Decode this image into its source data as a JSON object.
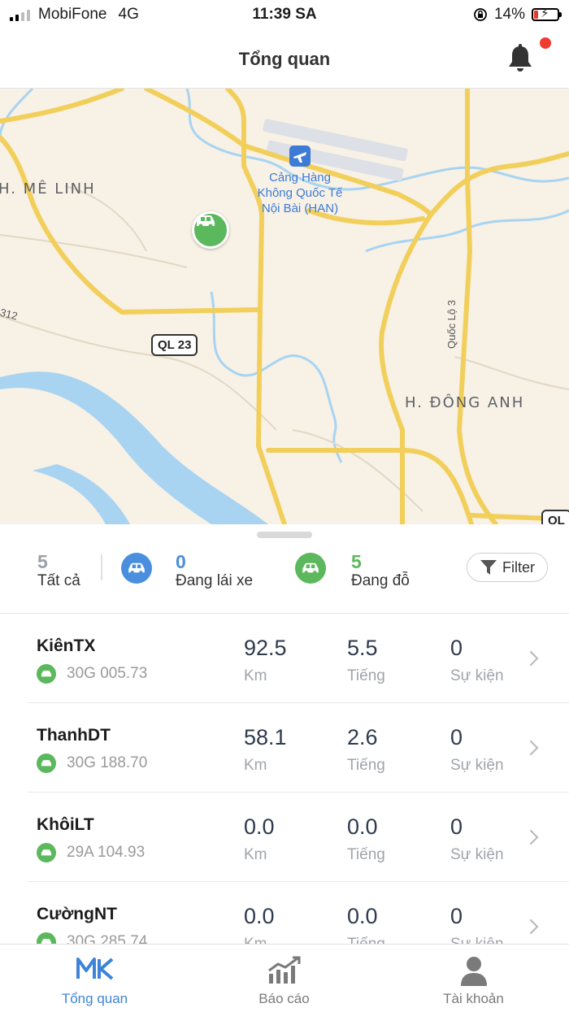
{
  "status_bar": {
    "carrier": "MobiFone",
    "network": "4G",
    "time": "11:39 SA",
    "battery": "14%"
  },
  "header": {
    "title": "Tổng quan"
  },
  "map": {
    "labels": {
      "me_linh": "H. MÊ LINH",
      "dong_anh": "H. ĐÔNG ANH",
      "airport_line1": "Cảng Hàng",
      "airport_line2": "Không Quốc Tế",
      "airport_line3": "Nội Bài (HAN)",
      "ql23": "QL 23",
      "quoc_lo_3": "Quốc Lộ 3",
      "road_312": "312",
      "ql_edge": "QL"
    }
  },
  "summary": {
    "all_count": "5",
    "all_label": "Tất cả",
    "driving_count": "0",
    "driving_label": "Đang lái xe",
    "parked_count": "5",
    "parked_label": "Đang đỗ",
    "filter_label": "Filter",
    "colors": {
      "driving": "#4a8fdd",
      "parked": "#5cb85c",
      "muted": "#9aa0a6"
    }
  },
  "vehicles": [
    {
      "name": "KiênTX",
      "plate": "30G 005.73",
      "km": "92.5",
      "hours": "5.5",
      "events": "0"
    },
    {
      "name": "ThanhDT",
      "plate": "30G 188.70",
      "km": "58.1",
      "hours": "2.6",
      "events": "0"
    },
    {
      "name": "KhôiLT",
      "plate": "29A 104.93",
      "km": "0.0",
      "hours": "0.0",
      "events": "0"
    },
    {
      "name": "CườngNT",
      "plate": "30G 285.74",
      "km": "0.0",
      "hours": "0.0",
      "events": "0"
    }
  ],
  "units": {
    "km": "Km",
    "hours": "Tiếng",
    "events": "Sự kiện"
  },
  "tabs": [
    {
      "label": "Tổng quan",
      "icon": "mk-logo-icon",
      "active": true
    },
    {
      "label": "Báo cáo",
      "icon": "chart-icon",
      "active": false
    },
    {
      "label": "Tài khoản",
      "icon": "user-icon",
      "active": false
    }
  ]
}
